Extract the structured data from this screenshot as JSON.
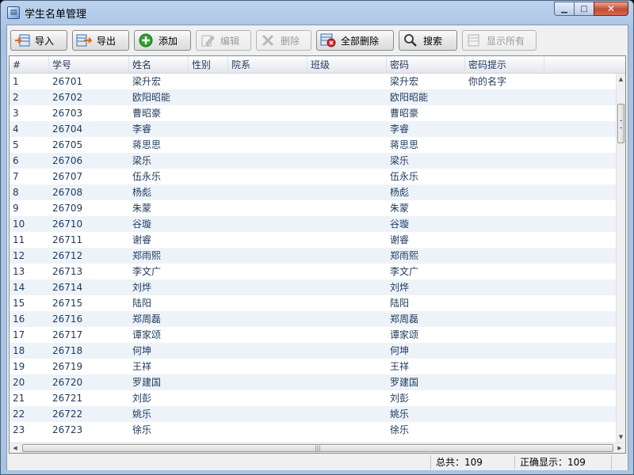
{
  "window": {
    "title": "学生名单管理"
  },
  "toolbar": {
    "import": "导入",
    "export": "导出",
    "add": "添加",
    "edit": "编辑",
    "delete": "删除",
    "delete_all": "全部删除",
    "search": "搜索",
    "show_all": "显示所有"
  },
  "table": {
    "columns": [
      "#",
      "学号",
      "姓名",
      "性别",
      "院系",
      "班级",
      "密码",
      "密码提示"
    ],
    "rows": [
      [
        "1",
        "26701",
        "梁升宏",
        "",
        "",
        "",
        "梁升宏",
        "你的名字"
      ],
      [
        "2",
        "26702",
        "欧阳昭能",
        "",
        "",
        "",
        "欧阳昭能",
        ""
      ],
      [
        "3",
        "26703",
        "曹昭豪",
        "",
        "",
        "",
        "曹昭豪",
        ""
      ],
      [
        "4",
        "26704",
        "李睿",
        "",
        "",
        "",
        "李睿",
        ""
      ],
      [
        "5",
        "26705",
        "蒋思思",
        "",
        "",
        "",
        "蒋思思",
        ""
      ],
      [
        "6",
        "26706",
        "梁乐",
        "",
        "",
        "",
        "梁乐",
        ""
      ],
      [
        "7",
        "26707",
        "伍永乐",
        "",
        "",
        "",
        "伍永乐",
        ""
      ],
      [
        "8",
        "26708",
        "杨彪",
        "",
        "",
        "",
        "杨彪",
        ""
      ],
      [
        "9",
        "26709",
        "朱蒙",
        "",
        "",
        "",
        "朱蒙",
        ""
      ],
      [
        "10",
        "26710",
        "谷璇",
        "",
        "",
        "",
        "谷璇",
        ""
      ],
      [
        "11",
        "26711",
        "谢睿",
        "",
        "",
        "",
        "谢睿",
        ""
      ],
      [
        "12",
        "26712",
        "郑雨熙",
        "",
        "",
        "",
        "郑雨熙",
        ""
      ],
      [
        "13",
        "26713",
        "李文广",
        "",
        "",
        "",
        "李文广",
        ""
      ],
      [
        "14",
        "26714",
        "刘烨",
        "",
        "",
        "",
        "刘烨",
        ""
      ],
      [
        "15",
        "26715",
        "陆阳",
        "",
        "",
        "",
        "陆阳",
        ""
      ],
      [
        "16",
        "26716",
        "郑周磊",
        "",
        "",
        "",
        "郑周磊",
        ""
      ],
      [
        "17",
        "26717",
        "谭家颂",
        "",
        "",
        "",
        "谭家颂",
        ""
      ],
      [
        "18",
        "26718",
        "何坤",
        "",
        "",
        "",
        "何坤",
        ""
      ],
      [
        "19",
        "26719",
        "王祥",
        "",
        "",
        "",
        "王祥",
        ""
      ],
      [
        "20",
        "26720",
        "罗建国",
        "",
        "",
        "",
        "罗建国",
        ""
      ],
      [
        "21",
        "26721",
        "刘彭",
        "",
        "",
        "",
        "刘彭",
        ""
      ],
      [
        "22",
        "26722",
        "姚乐",
        "",
        "",
        "",
        "姚乐",
        ""
      ],
      [
        "23",
        "26723",
        "徐乐",
        "",
        "",
        "",
        "徐乐",
        ""
      ]
    ]
  },
  "status": {
    "total": "总共：109",
    "shown": "正确显示：109"
  },
  "colors": {
    "accent": "#1e395b",
    "row_alt": "#eef3fa",
    "close": "#c24b31"
  }
}
